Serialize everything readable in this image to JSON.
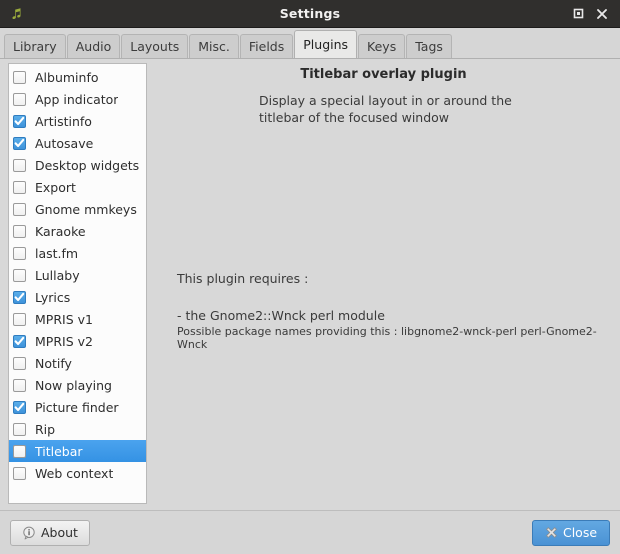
{
  "window": {
    "title": "Settings",
    "app_icon": "music-note-icon",
    "controls": [
      {
        "name": "maximize-button",
        "icon": "maximize-icon"
      },
      {
        "name": "close-button",
        "icon": "close-icon"
      }
    ]
  },
  "tabs": [
    {
      "label": "Library",
      "active": false
    },
    {
      "label": "Audio",
      "active": false
    },
    {
      "label": "Layouts",
      "active": false
    },
    {
      "label": "Misc.",
      "active": false
    },
    {
      "label": "Fields",
      "active": false
    },
    {
      "label": "Plugins",
      "active": true
    },
    {
      "label": "Keys",
      "active": false
    },
    {
      "label": "Tags",
      "active": false
    }
  ],
  "plugin_list": [
    {
      "label": "Albuminfo",
      "checked": false,
      "selected": false
    },
    {
      "label": "App indicator",
      "checked": false,
      "selected": false
    },
    {
      "label": "Artistinfo",
      "checked": true,
      "selected": false
    },
    {
      "label": "Autosave",
      "checked": true,
      "selected": false
    },
    {
      "label": "Desktop widgets",
      "checked": false,
      "selected": false
    },
    {
      "label": "Export",
      "checked": false,
      "selected": false
    },
    {
      "label": "Gnome mmkeys",
      "checked": false,
      "selected": false
    },
    {
      "label": "Karaoke",
      "checked": false,
      "selected": false
    },
    {
      "label": "last.fm",
      "checked": false,
      "selected": false
    },
    {
      "label": "Lullaby",
      "checked": false,
      "selected": false
    },
    {
      "label": "Lyrics",
      "checked": true,
      "selected": false
    },
    {
      "label": "MPRIS v1",
      "checked": false,
      "selected": false
    },
    {
      "label": "MPRIS v2",
      "checked": true,
      "selected": false
    },
    {
      "label": "Notify",
      "checked": false,
      "selected": false
    },
    {
      "label": "Now playing",
      "checked": false,
      "selected": false
    },
    {
      "label": "Picture finder",
      "checked": true,
      "selected": false
    },
    {
      "label": "Rip",
      "checked": false,
      "selected": false
    },
    {
      "label": "Titlebar",
      "checked": false,
      "selected": true
    },
    {
      "label": "Web context",
      "checked": false,
      "selected": false
    }
  ],
  "detail": {
    "title": "Titlebar overlay plugin",
    "description": "Display a special layout in or around the titlebar of the focused window",
    "requires_heading": "This plugin requires :",
    "requires_item": "- the Gnome2::Wnck perl module",
    "requires_note": "Possible package names providing this : libgnome2-wnck-perl perl-Gnome2-Wnck"
  },
  "footer": {
    "about_label": "About",
    "about_icon": "info-icon",
    "close_label": "Close",
    "close_icon": "x-mark-icon"
  },
  "colors": {
    "titlebar_bg": "#302f2d",
    "selection_blue": "#3e9cea",
    "checkbox_blue": "#4a9ce0",
    "close_button_blue": "#4a92d4",
    "panel_bg": "#d6d6d6",
    "list_bg": "#fcfcfc"
  }
}
